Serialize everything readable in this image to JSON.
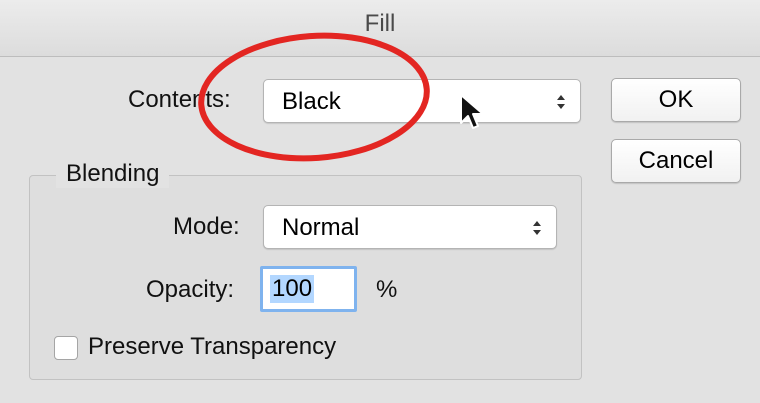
{
  "dialog": {
    "title": "Fill",
    "contents_label": "Contents:",
    "contents_value": "Black",
    "ok_label": "OK",
    "cancel_label": "Cancel"
  },
  "blending": {
    "group_title": "Blending",
    "mode_label": "Mode:",
    "mode_value": "Normal",
    "opacity_label": "Opacity:",
    "opacity_value": "100",
    "opacity_unit": "%",
    "preserve_label": "Preserve Transparency",
    "preserve_checked": false
  },
  "colors": {
    "annotation_circle": "#e32622",
    "selection": "#b3d7ff",
    "focus_ring": "#7fb3ee"
  },
  "icons": {
    "select_arrows": "updown-arrows-icon",
    "cursor": "mouse-pointer-icon"
  }
}
